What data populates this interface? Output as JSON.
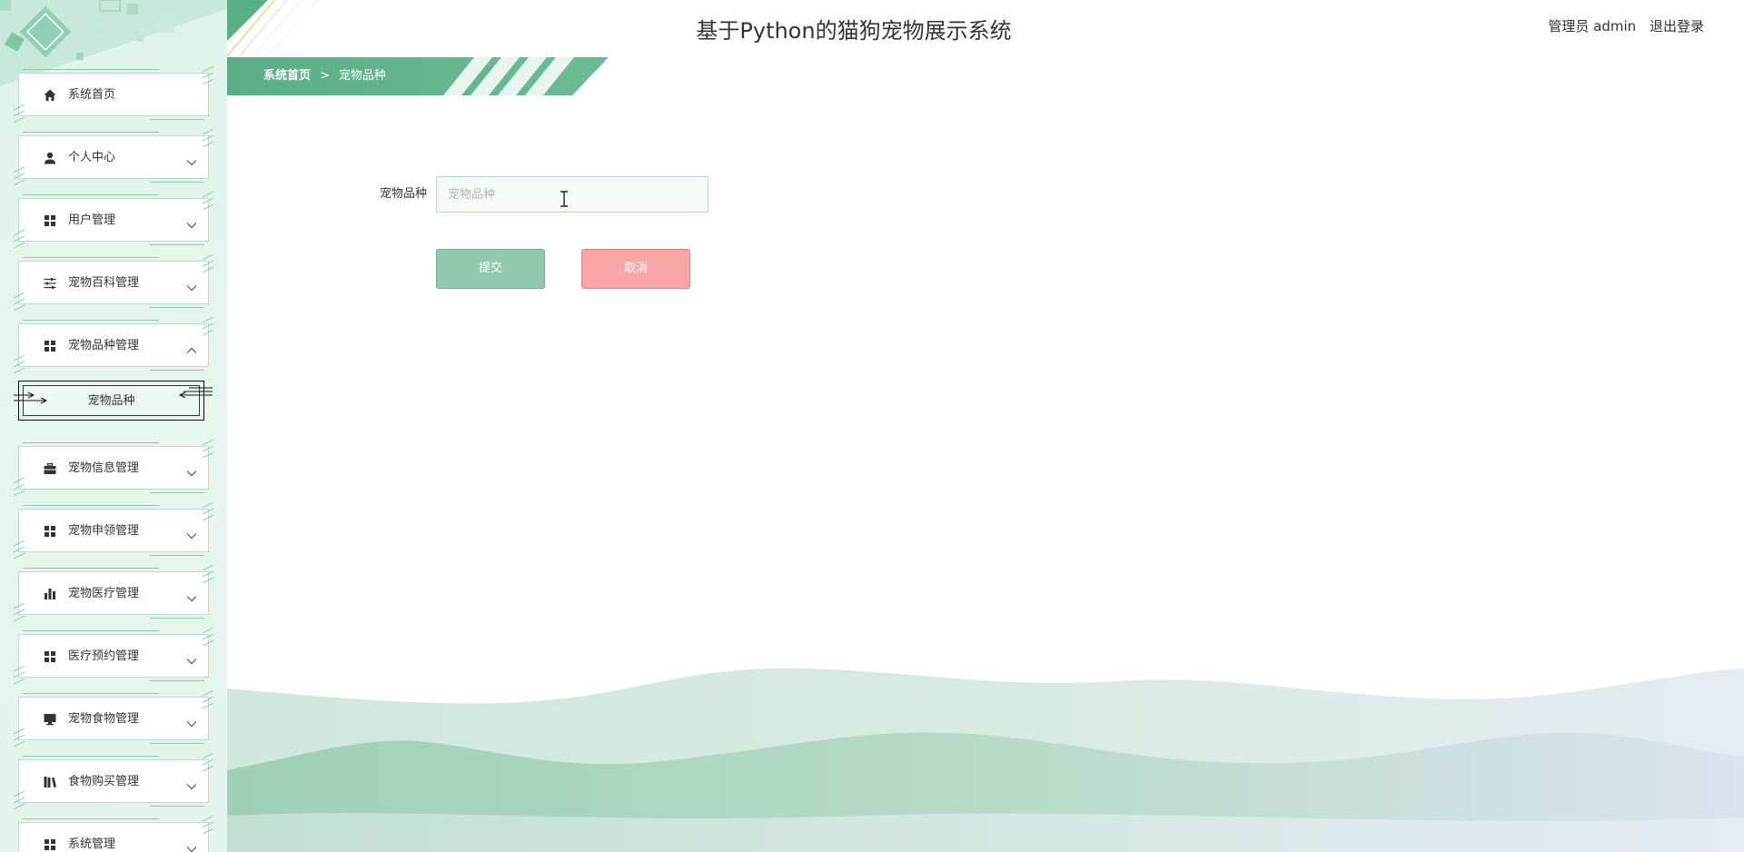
{
  "app": {
    "title": "基于Python的猫狗宠物展示系统"
  },
  "user": {
    "role_name": "管理员 admin",
    "logout_label": "退出登录"
  },
  "breadcrumb": {
    "home": "系统首页",
    "separator": ">",
    "current": "宠物品种"
  },
  "sidebar": {
    "items": [
      {
        "label": "系统首页",
        "icon": "home-icon",
        "expandable": false
      },
      {
        "label": "个人中心",
        "icon": "person-icon",
        "expandable": true,
        "expanded": false
      },
      {
        "label": "用户管理",
        "icon": "grid-icon",
        "expandable": true,
        "expanded": false
      },
      {
        "label": "宠物百科管理",
        "icon": "sliders-icon",
        "expandable": true,
        "expanded": false
      },
      {
        "label": "宠物品种管理",
        "icon": "grid-icon",
        "expandable": true,
        "expanded": true
      },
      {
        "label": "宠物信息管理",
        "icon": "briefcase-icon",
        "expandable": true,
        "expanded": false
      },
      {
        "label": "宠物申领管理",
        "icon": "grid-icon",
        "expandable": true,
        "expanded": false
      },
      {
        "label": "宠物医疗管理",
        "icon": "bar-chart-icon",
        "expandable": true,
        "expanded": false
      },
      {
        "label": "医疗预约管理",
        "icon": "grid-icon",
        "expandable": true,
        "expanded": false
      },
      {
        "label": "宠物食物管理",
        "icon": "monitor-icon",
        "expandable": true,
        "expanded": false
      },
      {
        "label": "食物购买管理",
        "icon": "books-icon",
        "expandable": true,
        "expanded": false
      },
      {
        "label": "系统管理",
        "icon": "grid-icon",
        "expandable": true,
        "expanded": false
      }
    ],
    "submenu": {
      "label": "宠物品种"
    }
  },
  "form": {
    "field_label": "宠物品种",
    "field_value": "",
    "field_placeholder": "宠物品种",
    "submit_label": "提交",
    "cancel_label": "取消"
  },
  "colors": {
    "primary": "#5aae85",
    "primary_light": "#91c9ae",
    "cancel": "#fba6a6",
    "sidebar_bg": "#e3f4ec"
  }
}
